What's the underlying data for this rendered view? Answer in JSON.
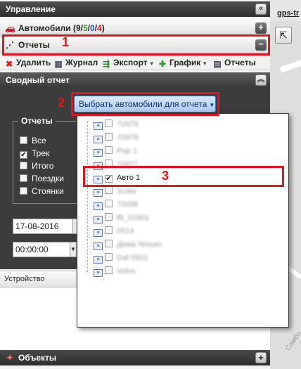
{
  "panel": {
    "title": "Управление",
    "collapse_icon": "double-chevron-left-icon"
  },
  "cars": {
    "label": "Автомобили",
    "count_open": " (9/",
    "count_green": "5",
    "sep1": "/",
    "count_blue": "0",
    "sep2": "/",
    "count_red": "4",
    "count_close": ")",
    "toggle": "+"
  },
  "reports": {
    "label": "Отчеты",
    "toggle": "−"
  },
  "toolbar": {
    "delete": "Удалить",
    "journal": "Журнал",
    "export": "Экспорт",
    "graph": "График",
    "reports": "Отчеты"
  },
  "summary": {
    "title": "Сводный отчет",
    "toggle": "︽"
  },
  "pick_button": "Выбрать автомобили для отчета",
  "report_group": {
    "legend": "Отчеты",
    "options": [
      {
        "label": "Все",
        "checked": false
      },
      {
        "label": "Трек",
        "checked": true
      },
      {
        "label": "Итого",
        "checked": false
      },
      {
        "label": "Поездки",
        "checked": false
      },
      {
        "label": "Стоянки",
        "checked": false
      }
    ]
  },
  "date_value": "17-08-2016",
  "time_value": "00:00:00",
  "device_header": "Устройство",
  "dropdown": {
    "items": [
      {
        "label": "70979",
        "checked": false,
        "blurred": true
      },
      {
        "label": "70978",
        "checked": false,
        "blurred": true
      },
      {
        "label": "Pop 1",
        "checked": false,
        "blurred": true
      },
      {
        "label": "70977",
        "checked": false,
        "blurred": true
      },
      {
        "label": "Авто 1",
        "checked": true,
        "blurred": false
      },
      {
        "label": "Scala",
        "checked": false,
        "blurred": true
      },
      {
        "label": "70096",
        "checked": false,
        "blurred": true
      },
      {
        "label": "Bl_01601",
        "checked": false,
        "blurred": true
      },
      {
        "label": "0514",
        "checked": false,
        "blurred": true
      },
      {
        "label": "Дима Nissan",
        "checked": false,
        "blurred": true
      },
      {
        "label": "Daf 0501",
        "checked": false,
        "blurred": true
      },
      {
        "label": "Volvo",
        "checked": false,
        "blurred": true
      }
    ]
  },
  "objects": {
    "label": "Объекты",
    "toggle": "+"
  },
  "map_tab": "gps-tr",
  "map_label": "Самбо",
  "annotations": [
    "1",
    "2",
    "3"
  ]
}
